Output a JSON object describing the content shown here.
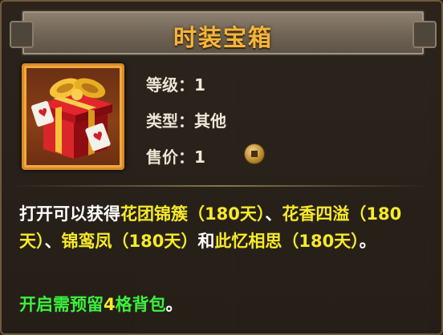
{
  "item": {
    "title": "时装宝箱",
    "icon": "gift-box-icon",
    "attributes": [
      {
        "label": "等级：",
        "value": "1"
      },
      {
        "label": "类型：",
        "value": "其他"
      },
      {
        "label": "售价：",
        "value": "1",
        "currency_icon": "coin-icon"
      }
    ]
  },
  "description": {
    "seg1": "打开可以获得",
    "item1": "花团锦簇（180天）",
    "sep1": "、",
    "item2": "花香四溢（180天）",
    "sep2": "、",
    "item3": "锦鸾凤（180天）",
    "sep3": "和",
    "item4": "此忆相思（180天）",
    "end": "。"
  },
  "tip": {
    "green": "开启需预留",
    "count": "4",
    "green2": "格背包",
    "end": "。"
  },
  "colors": {
    "title": "#f5b43a",
    "highlight": "#f7ea2a",
    "green": "#3cf23c",
    "frame": "#d98a2a"
  }
}
